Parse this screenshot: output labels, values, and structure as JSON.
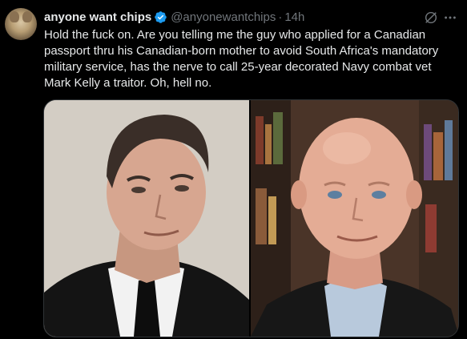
{
  "tweet": {
    "author_name": "anyone want chips",
    "handle": "@anyonewantchips",
    "separator": "·",
    "time": "14h",
    "text": "Hold the fuck on. Are you telling me the guy who applied for a Canadian passport thru his Canadian-born mother to avoid South Africa's mandatory military service, has the nerve to call 25-year decorated Navy combat vet Mark Kelly a traitor. Oh, hell no."
  },
  "icons": {
    "verified": "verified-badge-icon",
    "grok": "grok-icon",
    "more": "more-options-icon"
  },
  "colors": {
    "background": "#000000",
    "text": "#e7e9ea",
    "muted": "#71767b",
    "verified": "#1d9bf0"
  }
}
